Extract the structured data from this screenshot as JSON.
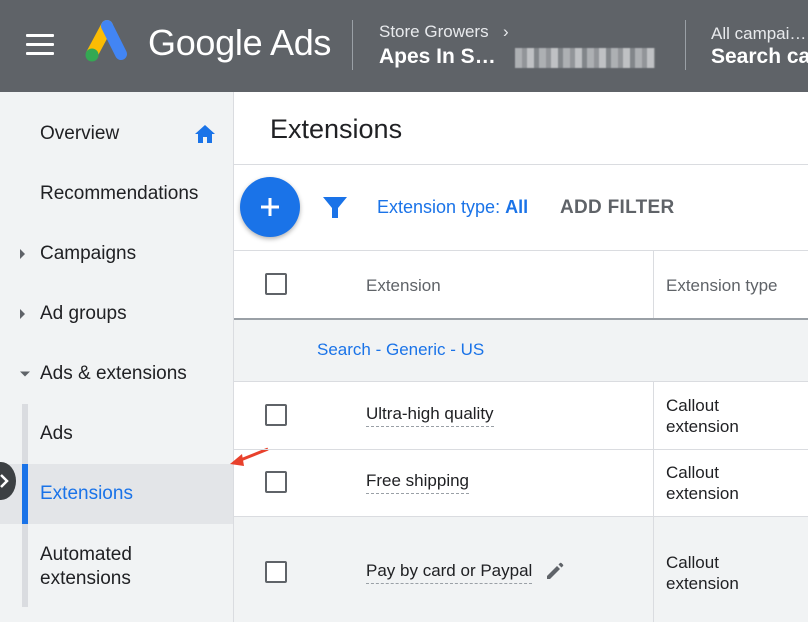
{
  "header": {
    "brand": "Google Ads",
    "account_manager": "Store Growers",
    "account_name": "Apes In S…",
    "campaign_scope": "All campai…",
    "campaign_name": "Search ca"
  },
  "sidebar": {
    "items": [
      {
        "label": "Overview",
        "icon": "home-icon"
      },
      {
        "label": "Recommendations"
      },
      {
        "label": "Campaigns",
        "caret": "right"
      },
      {
        "label": "Ad groups",
        "caret": "right"
      },
      {
        "label": "Ads & extensions",
        "caret": "down"
      },
      {
        "label": "Ads"
      },
      {
        "label": "Extensions",
        "active": true
      },
      {
        "label": "Automated extensions"
      }
    ]
  },
  "page": {
    "title": "Extensions",
    "filter_label": "Extension type:",
    "filter_value": "All",
    "add_filter": "ADD FILTER"
  },
  "table": {
    "columns": [
      "Extension",
      "Extension type"
    ],
    "group": "Search - Generic - US",
    "rows": [
      {
        "extension": "Ultra-high quality",
        "type": "Callout extension"
      },
      {
        "extension": "Free shipping",
        "type": "Callout extension"
      },
      {
        "extension": "Pay by card or Paypal",
        "type": "Callout extension"
      }
    ]
  },
  "colors": {
    "topbar": "#5f6368",
    "accent": "#1a73e8",
    "annotation_arrow": "#e8412c"
  }
}
